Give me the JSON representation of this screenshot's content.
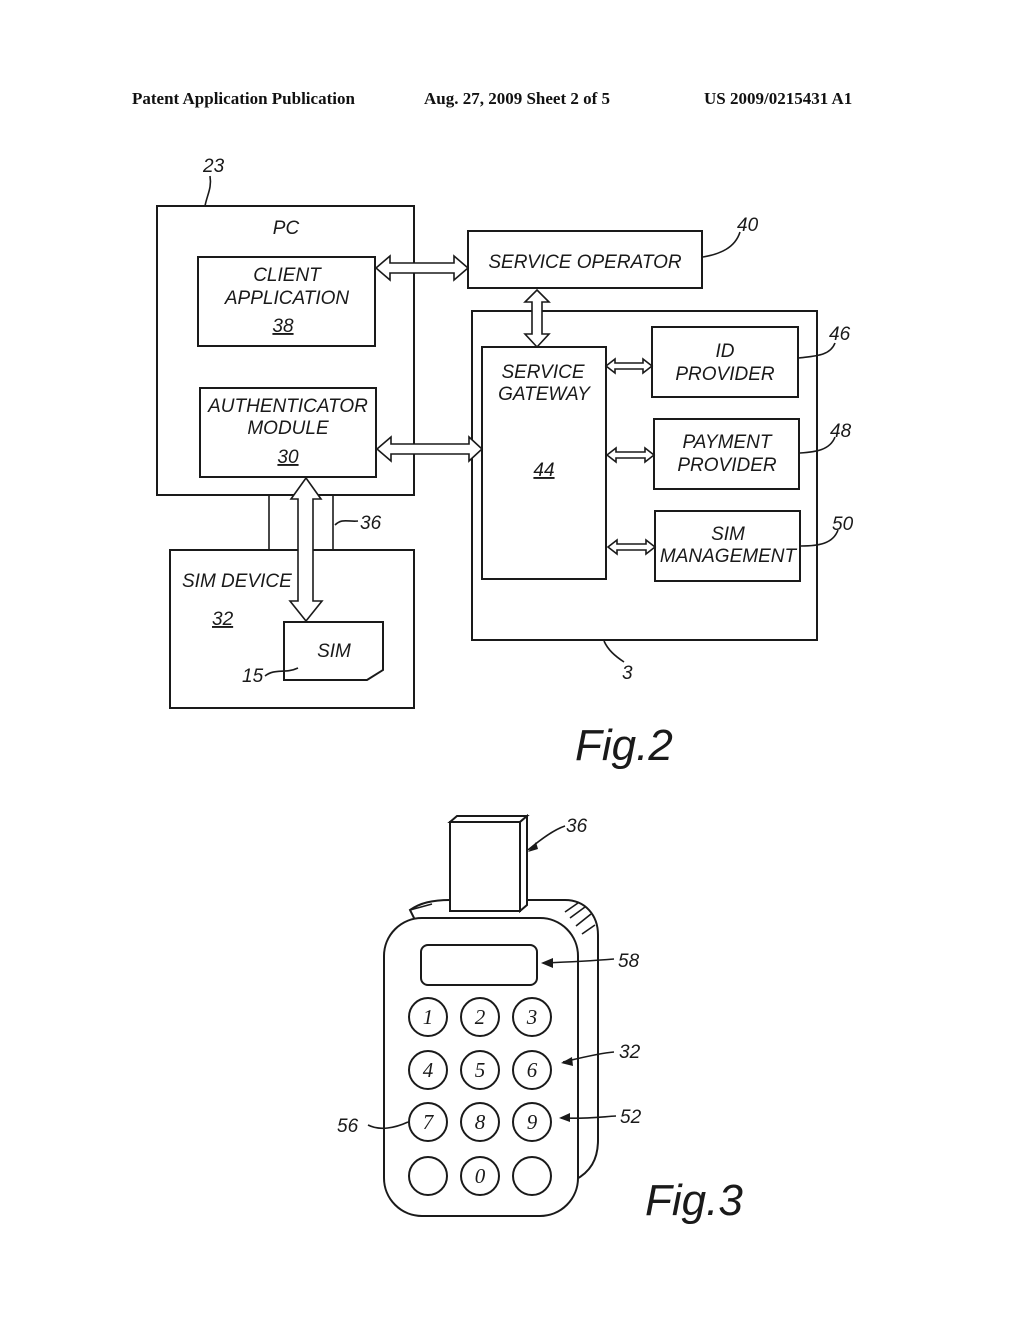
{
  "header": {
    "left": "Patent Application Publication",
    "center": "Aug. 27, 2009  Sheet 2 of 5",
    "right": "US 2009/0215431 A1"
  },
  "fig2": {
    "caption": "Fig.2",
    "pc": {
      "ref": "23",
      "title": "PC"
    },
    "client_app": {
      "line1": "CLIENT",
      "line2": "APPLICATION",
      "ref": "38"
    },
    "auth_module": {
      "line1": "AUTHENTICATOR",
      "line2": "MODULE",
      "ref": "30"
    },
    "sim_device": {
      "title": "SIM DEVICE",
      "ref": "32"
    },
    "sim": {
      "label": "SIM",
      "ref": "15"
    },
    "connector_ref": "36",
    "service_operator": {
      "label": "SERVICE OPERATOR",
      "ref": "40"
    },
    "backend_ref": "3",
    "service_gateway": {
      "line1": "SERVICE",
      "line2": "GATEWAY",
      "ref": "44"
    },
    "id_provider": {
      "line1": "ID",
      "line2": "PROVIDER",
      "ref": "46"
    },
    "payment_provider": {
      "line1": "PAYMENT",
      "line2": "PROVIDER",
      "ref": "48"
    },
    "sim_management": {
      "line1": "SIM",
      "line2": "MANAGEMENT",
      "ref": "50"
    }
  },
  "fig3": {
    "caption": "Fig.3",
    "refs": {
      "connector": "36",
      "display": "58",
      "device": "32",
      "keypad": "52",
      "key": "56"
    },
    "keys": [
      "1",
      "2",
      "3",
      "4",
      "5",
      "6",
      "7",
      "8",
      "9",
      "",
      "0",
      ""
    ]
  }
}
